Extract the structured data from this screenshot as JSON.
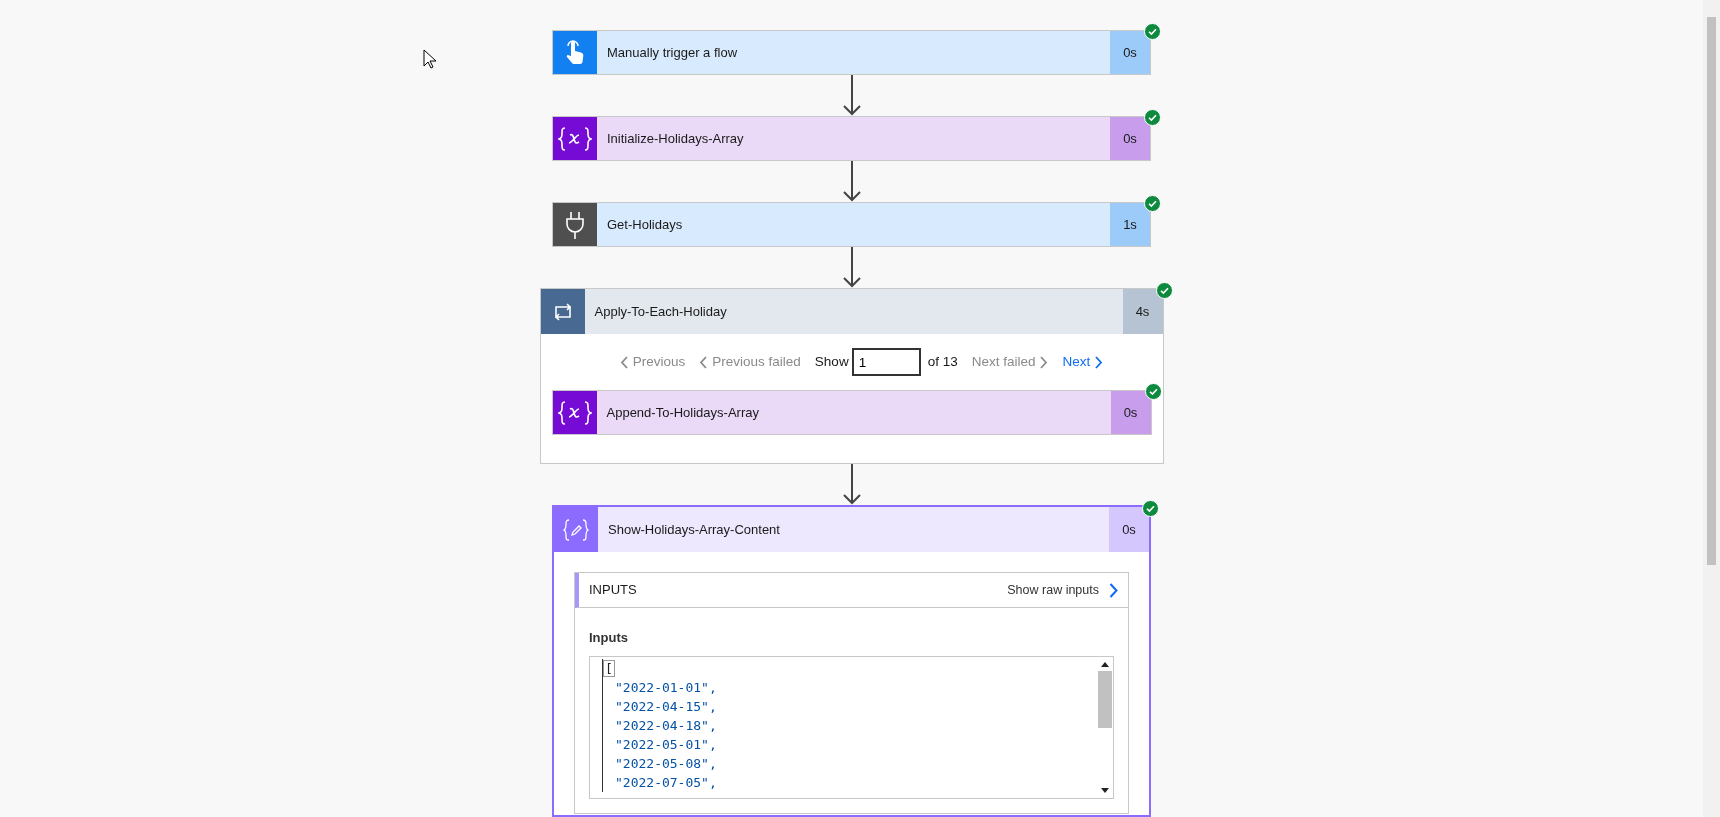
{
  "steps": [
    {
      "kind": "trigger",
      "title": "Manually trigger a flow",
      "duration": "0s",
      "succeeded": true
    },
    {
      "kind": "variable",
      "title": "Initialize-Holidays-Array",
      "duration": "0s",
      "succeeded": true
    },
    {
      "kind": "connector",
      "title": "Get-Holidays",
      "duration": "1s",
      "succeeded": true
    },
    {
      "kind": "loop",
      "title": "Apply-To-Each-Holiday",
      "duration": "4s",
      "succeeded": true,
      "pager": {
        "previous": {
          "label": "Previous",
          "disabled": true
        },
        "previous_failed": {
          "label": "Previous failed",
          "disabled": true
        },
        "show_label": "Show",
        "value": "1",
        "of": "of 13",
        "next_failed": {
          "label": "Next failed",
          "disabled": true
        },
        "next": {
          "label": "Next",
          "disabled": false
        }
      },
      "children": [
        {
          "kind": "variable",
          "title": "Append-To-Holidays-Array",
          "duration": "0s",
          "succeeded": true
        }
      ]
    },
    {
      "kind": "compose",
      "title": "Show-Holidays-Array-Content",
      "duration": "0s",
      "succeeded": true,
      "selected": true,
      "details": {
        "section_title": "INPUTS",
        "raw_link": "Show raw inputs",
        "field_label": "Inputs",
        "lines": [
          "[",
          "\"2022-01-01\",",
          "\"2022-04-15\",",
          "\"2022-04-18\",",
          "\"2022-05-01\",",
          "\"2022-05-08\",",
          "\"2022-07-05\","
        ]
      }
    }
  ]
}
